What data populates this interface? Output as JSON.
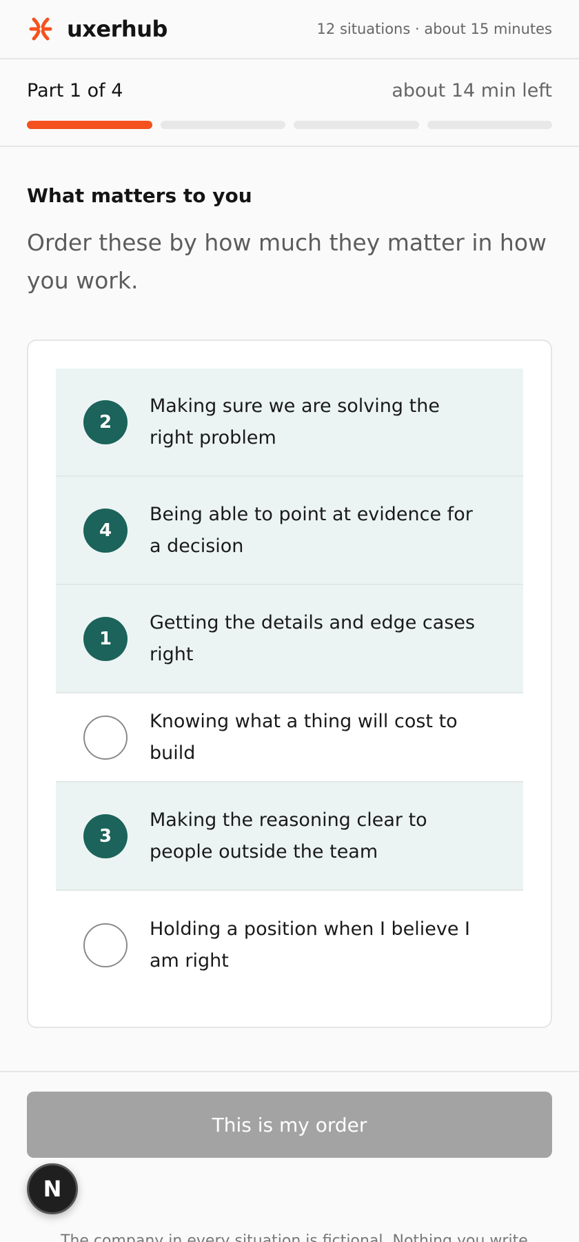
{
  "header": {
    "brand": "uxerhub",
    "meta": "12 situations · about 15 minutes"
  },
  "progress": {
    "part_label": "Part 1 of 4",
    "time_left": "about 14 min left",
    "current_part": 1,
    "total_parts": 4,
    "accent_color": "#f4511e"
  },
  "question": {
    "title": "What matters to you",
    "instructions": "Order these by how much they matter in how you work.",
    "items": [
      {
        "rank": "2",
        "label": "Making sure we are solving the right problem"
      },
      {
        "rank": "4",
        "label": "Being able to point at evidence for a decision"
      },
      {
        "rank": "1",
        "label": "Getting the details and edge cases right"
      },
      {
        "rank": "",
        "label": "Knowing what a thing will cost to build"
      },
      {
        "rank": "3",
        "label": "Making the reasoning clear to people outside the team"
      },
      {
        "rank": "",
        "label": "Holding a position when I believe I am right"
      }
    ],
    "rank_color": "#1b635b",
    "ranked_row_color": "#ecf4f3"
  },
  "footer": {
    "submit_label": "This is my order",
    "badge_letter": "N",
    "disclaimer": "The company in every situation is fictional. Nothing you write"
  }
}
